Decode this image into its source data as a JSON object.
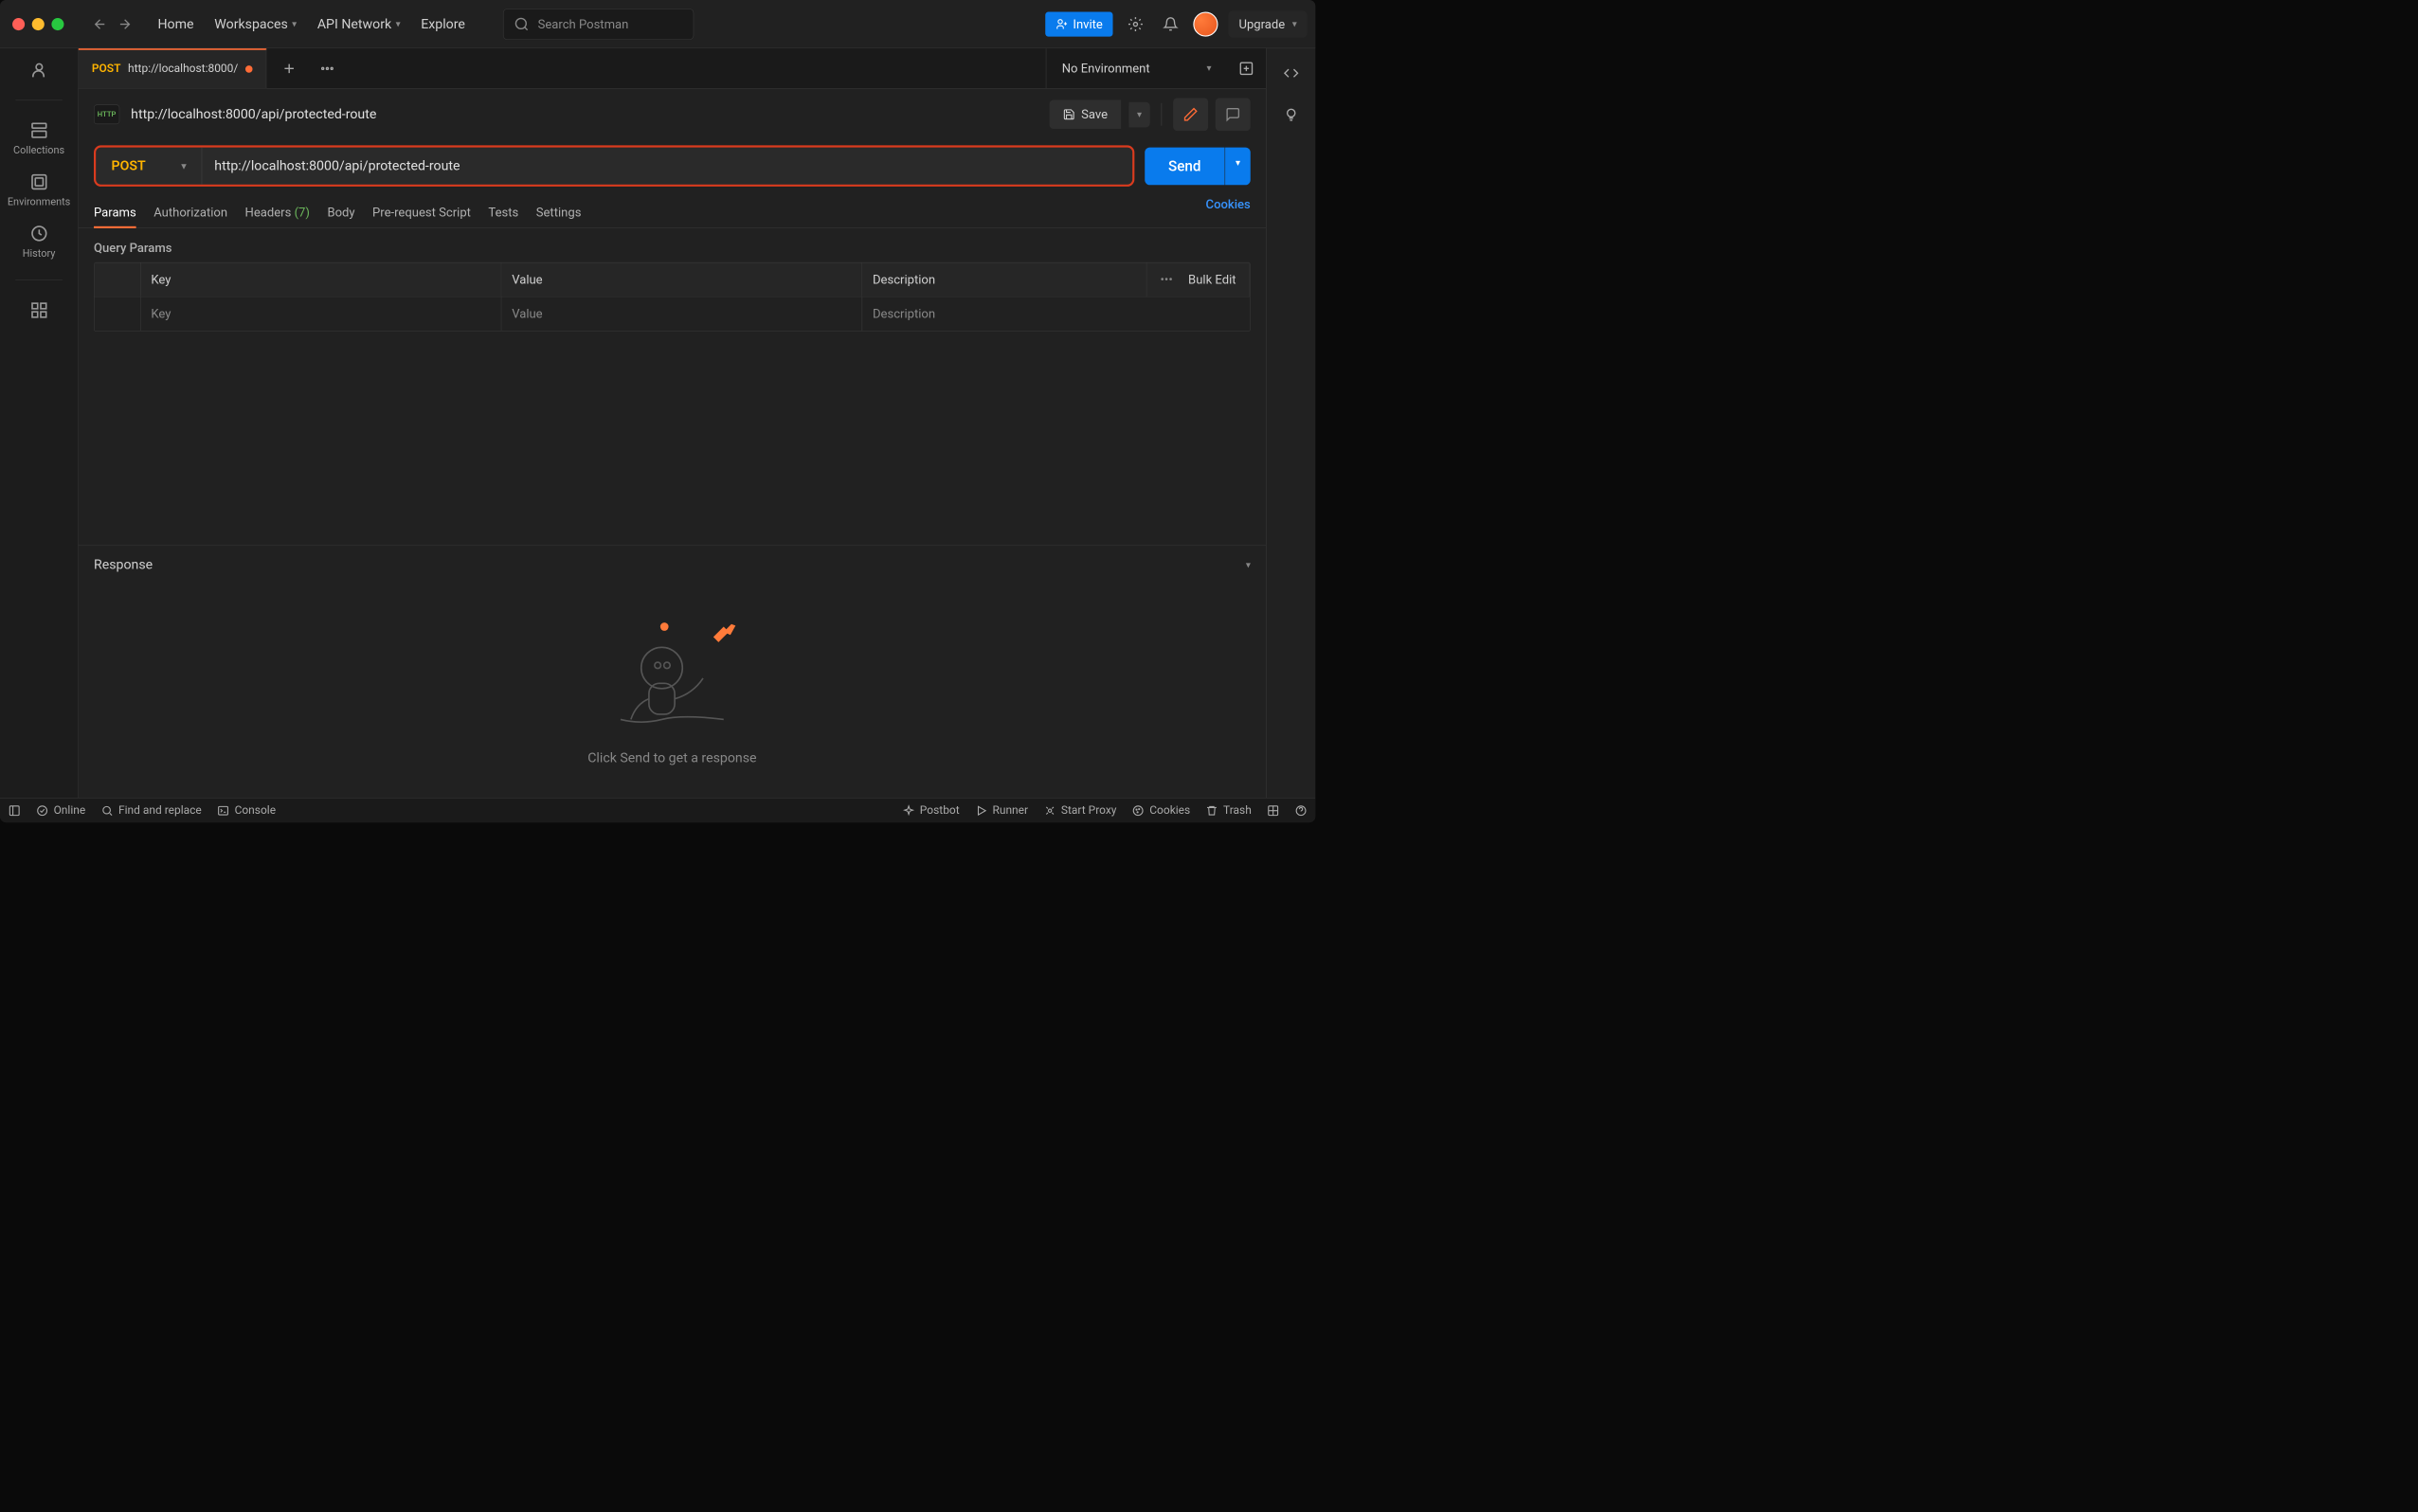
{
  "topnav": {
    "home": "Home",
    "workspaces": "Workspaces",
    "api_network": "API Network",
    "explore": "Explore"
  },
  "search": {
    "placeholder": "Search Postman"
  },
  "invite_label": "Invite",
  "upgrade_label": "Upgrade",
  "sidebar": {
    "collections": "Collections",
    "environments": "Environments",
    "history": "History"
  },
  "tab": {
    "method": "POST",
    "title": "http://localhost:8000/"
  },
  "env_selector": "No Environment",
  "request": {
    "name": "http://localhost:8000/api/protected-route",
    "method": "POST",
    "url": "http://localhost:8000/api/protected-route",
    "save": "Save",
    "send": "Send"
  },
  "subtabs": {
    "params": "Params",
    "authorization": "Authorization",
    "headers": "Headers",
    "headers_count": "(7)",
    "body": "Body",
    "prerequest": "Pre-request Script",
    "tests": "Tests",
    "settings": "Settings",
    "cookies": "Cookies"
  },
  "query_params": {
    "title": "Query Params",
    "cols": {
      "key": "Key",
      "value": "Value",
      "description": "Description"
    },
    "bulk": "Bulk Edit",
    "placeholders": {
      "key": "Key",
      "value": "Value",
      "description": "Description"
    }
  },
  "response": {
    "title": "Response",
    "empty": "Click Send to get a response"
  },
  "statusbar": {
    "online": "Online",
    "find": "Find and replace",
    "console": "Console",
    "postbot": "Postbot",
    "runner": "Runner",
    "proxy": "Start Proxy",
    "cookies": "Cookies",
    "trash": "Trash"
  }
}
